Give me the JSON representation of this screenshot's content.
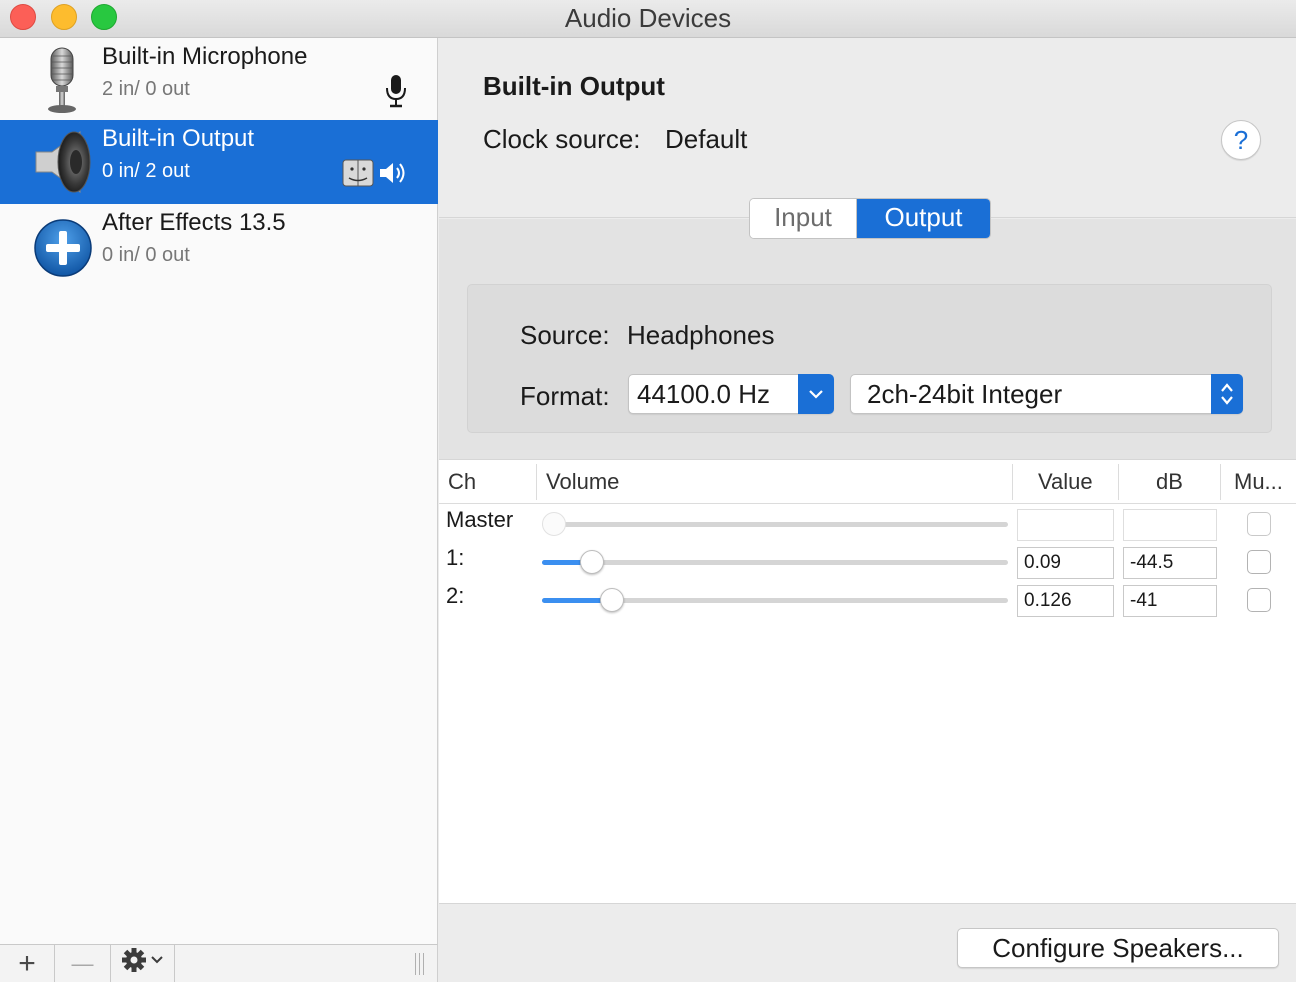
{
  "window": {
    "title": "Audio Devices"
  },
  "devices": [
    {
      "name": "Built-in Microphone",
      "io": "2 in/ 0 out",
      "icon": "microphone-icon",
      "selected": false
    },
    {
      "name": "Built-in Output",
      "io": "0 in/ 2 out",
      "icon": "speaker-icon",
      "selected": true
    },
    {
      "name": "After Effects 13.5",
      "io": "0 in/ 0 out",
      "icon": "plus-circle-icon",
      "selected": false
    }
  ],
  "sidebar_toolbar": {
    "add": "+",
    "remove": "—"
  },
  "detail": {
    "title": "Built-in Output",
    "clock_label": "Clock source:",
    "clock_value": "Default",
    "help": "?",
    "tabs": {
      "input": "Input",
      "output": "Output",
      "active": "Output"
    },
    "source_label": "Source:",
    "source_value": "Headphones",
    "format_label": "Format:",
    "sample_rate": "44100.0 Hz",
    "format": "2ch-24bit Integer"
  },
  "table": {
    "headers": {
      "ch": "Ch",
      "volume": "Volume",
      "value": "Value",
      "db": "dB",
      "mute": "Mu..."
    },
    "rows": [
      {
        "label": "Master",
        "value": "",
        "db": "",
        "level": 0,
        "enabled": false
      },
      {
        "label": "1:",
        "value": "0.09",
        "db": "-44.5",
        "level": 0.09,
        "enabled": true
      },
      {
        "label": "2:",
        "value": "0.126",
        "db": "-41",
        "level": 0.126,
        "enabled": true
      }
    ]
  },
  "configure_button": "Configure Speakers...",
  "colors": {
    "accent": "#1a6fd6",
    "slider_fill": "#3b8ff0"
  }
}
